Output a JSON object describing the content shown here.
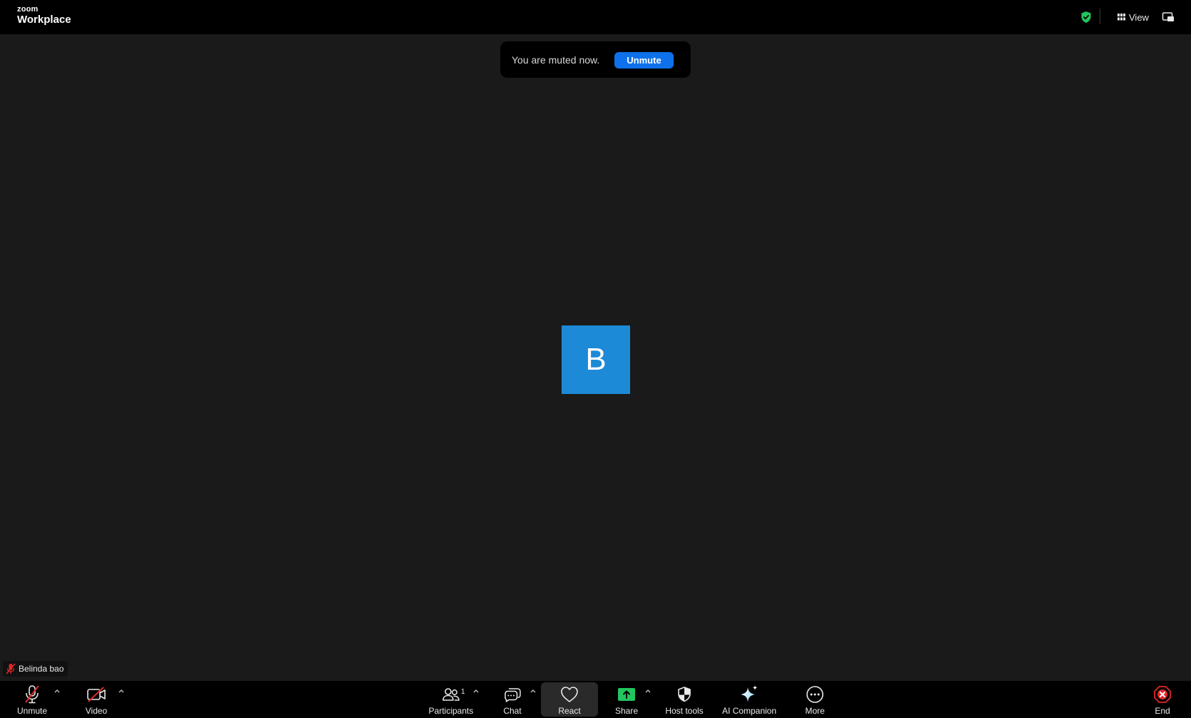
{
  "top_bar": {
    "logo_small": "zoom",
    "logo_big": "Workplace",
    "view_label": "View"
  },
  "toast": {
    "message": "You are muted now.",
    "unmute_label": "Unmute"
  },
  "participant": {
    "initial": "B",
    "name": "Belinda bao",
    "avatar_color": "#1d8ad8"
  },
  "toolbar": {
    "unmute_label": "Unmute",
    "video_label": "Video",
    "participants_label": "Participants",
    "participants_count": "1",
    "chat_label": "Chat",
    "react_label": "React",
    "share_label": "Share",
    "host_tools_label": "Host tools",
    "ai_companion_label": "AI Companion",
    "more_label": "More",
    "end_label": "End"
  },
  "colors": {
    "accent_blue": "#0e71eb",
    "share_green": "#22c55e",
    "end_red": "#e02828",
    "muted_red": "#e02828",
    "secure_green": "#22c55e"
  }
}
